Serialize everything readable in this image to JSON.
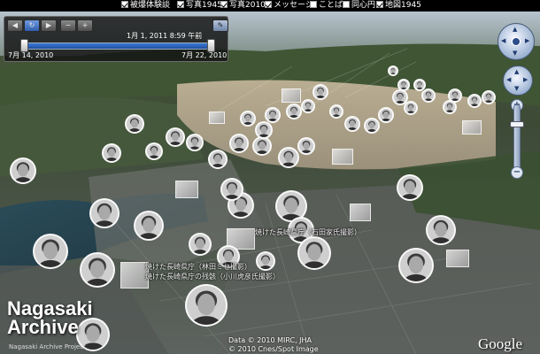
{
  "layers": [
    {
      "label": "被爆体験談",
      "checked": true
    },
    {
      "label": "写真1945",
      "checked": true
    },
    {
      "label": "写真2010",
      "checked": true
    },
    {
      "label": "メッセージ",
      "checked": true
    },
    {
      "label": "ことば",
      "checked": false
    },
    {
      "label": "同心円",
      "checked": false
    },
    {
      "label": "地図1945",
      "checked": true
    }
  ],
  "time_slider": {
    "current": "1月 1, 2011 8:59 午前",
    "start_label": "7月 14, 2010",
    "end_label": "7月 22, 2010",
    "start_handle_fraction": 0.0,
    "end_handle_fraction": 1.0
  },
  "map_captions": [
    "焼けた長崎県庁（石田家氏撮影）",
    "焼けた長崎県庁（林田ミセ撮影）",
    "焼けた長崎県庁の残骸（小川虎彦氏撮影）"
  ],
  "branding": {
    "title_line1": "Nagasaki",
    "title_line2": "Archive",
    "subtitle": "Nagasaki Archive Project",
    "data_credit": "Data © 2010 MIRC, JHA",
    "image_credit": "© 2010 Cnes/Spot Image",
    "google": "Google"
  },
  "icons": {
    "play": "play-icon",
    "loop": "loop-icon",
    "zoom_in": "zoom-in-icon",
    "zoom_out": "zoom-out-icon",
    "wrench": "wrench-icon",
    "look": "look-around-icon",
    "move": "move-arrows-icon"
  }
}
